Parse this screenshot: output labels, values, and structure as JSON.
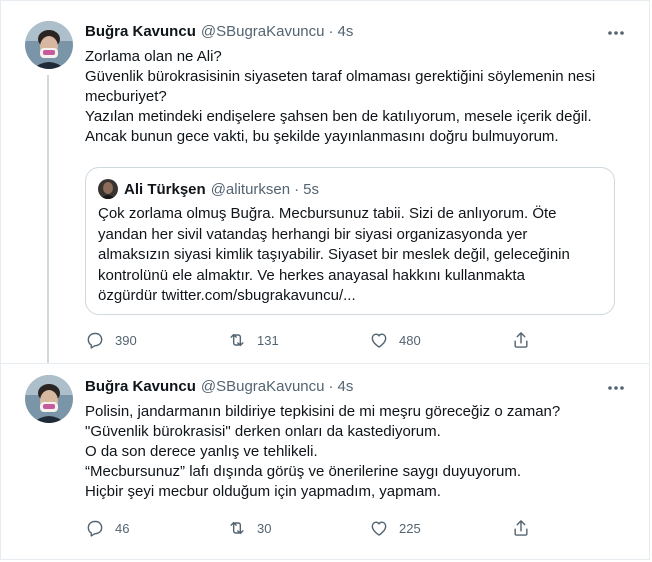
{
  "tweets": [
    {
      "author": {
        "name": "Buğra Kavuncu",
        "handle": "@SBugraKavuncu",
        "separator": "·",
        "time": "4s"
      },
      "text_lines": [
        "Zorlama olan ne Ali?",
        "Güvenlik bürokrasisinin siyaseten taraf olmaması gerektiğini söylemenin nesi",
        "mecburiyet?",
        "Yazılan metindeki endişelere şahsen ben de katılıyorum, mesele içerik değil.",
        "Ancak bunun gece vakti, bu şekilde yayınlanmasını doğru bulmuyorum."
      ],
      "quote": {
        "name": "Ali Türkşen",
        "handle": "@aliturksen",
        "separator": "·",
        "time": "5s",
        "text_lines": [
          "Çok zorlama olmuş Buğra. Mecbursunuz tabii. Sizi de anlıyorum. Öte",
          "yandan her sivil vatandaş herhangi bir siyasi organizasyonda yer",
          "almaksızın siyasi kimlik taşıyabilir. Siyaset bir meslek değil, geleceğinin",
          "kontrolünü ele almaktır. Ve herkes anayasal hakkını kullanmakta",
          "özgürdür twitter.com/sbugrakavuncu/..."
        ]
      },
      "actions": {
        "replies": "390",
        "retweets": "131",
        "likes": "480"
      }
    },
    {
      "author": {
        "name": "Buğra Kavuncu",
        "handle": "@SBugraKavuncu",
        "separator": "·",
        "time": "4s"
      },
      "text_lines": [
        "Polisin, jandarmanın bildiriye tepkisini de mi meşru göreceğiz o zaman?",
        "\"Güvenlik bürokrasisi\" derken onları da kastediyorum.",
        "O da son derece yanlış ve tehlikeli.",
        "“Mecbursunuz” lafı dışında görüş ve önerilerine saygı duyuyorum.",
        "Hiçbir şeyi mecbur olduğum için yapmadım, yapmam."
      ],
      "actions": {
        "replies": "46",
        "retweets": "30",
        "likes": "225"
      }
    }
  ],
  "colors": {
    "text": "#0f1419",
    "secondary": "#536471",
    "border": "#cfd9de",
    "thread_line": "#cfd9de"
  },
  "icons": {
    "more": "more-horizontal-icon",
    "reply": "reply-icon",
    "retweet": "retweet-icon",
    "like": "heart-icon",
    "share": "share-icon"
  }
}
